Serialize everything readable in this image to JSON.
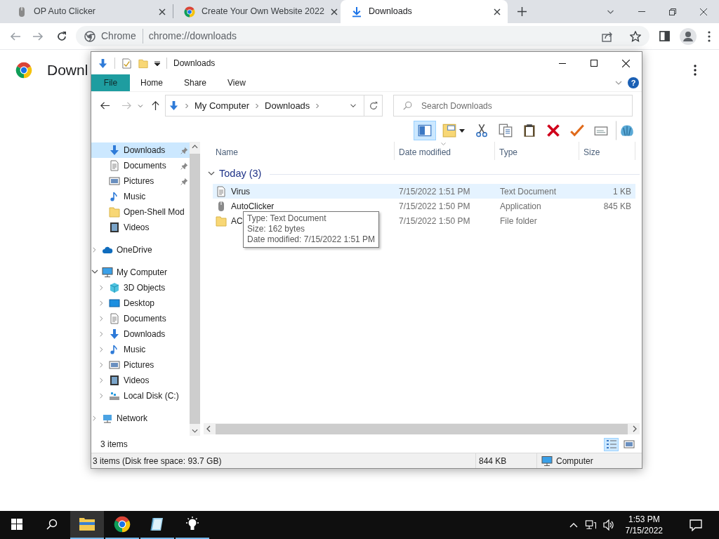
{
  "browser": {
    "tabs": [
      {
        "title": "OP Auto Clicker",
        "kind": "mouse",
        "selected": false
      },
      {
        "title": "Create Your Own Website 2022",
        "kind": "chrome",
        "selected": false
      },
      {
        "title": "Downloads",
        "kind": "download",
        "selected": true
      }
    ],
    "omnibox": {
      "chip": "Chrome",
      "url": "chrome://downloads"
    },
    "page": {
      "heading": "Downl"
    }
  },
  "explorer": {
    "title": "Downloads",
    "ribbon_tabs": [
      {
        "label": "File",
        "kind": "file",
        "selected": false
      },
      {
        "label": "Home",
        "kind": "tab",
        "selected": false
      },
      {
        "label": "Share",
        "kind": "tab",
        "selected": false
      },
      {
        "label": "View",
        "kind": "tab",
        "selected": false
      }
    ],
    "help": "?",
    "breadcrumb": [
      "My Computer",
      "Downloads"
    ],
    "search": {
      "placeholder": "Search Downloads"
    },
    "toolbar": [
      {
        "kind": "pane",
        "pressed": true
      },
      {
        "kind": "view",
        "pressed": false
      },
      {
        "kind": "cut",
        "pressed": false
      },
      {
        "kind": "copy",
        "pressed": false
      },
      {
        "kind": "paste",
        "pressed": false
      },
      {
        "kind": "delete",
        "pressed": false
      },
      {
        "kind": "properties",
        "pressed": false
      },
      {
        "kind": "rename",
        "pressed": false
      },
      {
        "kind": "shell",
        "pressed": false
      }
    ],
    "quick_access": [
      {
        "label": "Downloads",
        "kind": "downloads",
        "pinned": true,
        "selected": true
      },
      {
        "label": "Documents",
        "kind": "documents",
        "pinned": true,
        "selected": false
      },
      {
        "label": "Pictures",
        "kind": "pictures",
        "pinned": true,
        "selected": false
      },
      {
        "label": "Music",
        "kind": "music",
        "pinned": false,
        "selected": false
      },
      {
        "label": "Open-Shell Mod",
        "kind": "folder",
        "pinned": false,
        "selected": false
      },
      {
        "label": "Videos",
        "kind": "videos",
        "pinned": false,
        "selected": false
      }
    ],
    "tree": [
      {
        "label": "OneDrive",
        "kind": "onedrive",
        "expanded": false,
        "selected": false
      },
      {
        "label": "My Computer",
        "kind": "computer",
        "expanded": true,
        "selected": false,
        "children": [
          {
            "label": "3D Objects",
            "kind": "objects",
            "expanded": false,
            "selected": false
          },
          {
            "label": "Desktop",
            "kind": "desktop",
            "expanded": false,
            "selected": false
          },
          {
            "label": "Documents",
            "kind": "documents",
            "expanded": false,
            "selected": false
          },
          {
            "label": "Downloads",
            "kind": "downloads",
            "expanded": false,
            "selected": false
          },
          {
            "label": "Music",
            "kind": "music",
            "expanded": false,
            "selected": false
          },
          {
            "label": "Pictures",
            "kind": "pictures",
            "expanded": false,
            "selected": false
          },
          {
            "label": "Videos",
            "kind": "videos",
            "expanded": false,
            "selected": false
          },
          {
            "label": "Local Disk (C:)",
            "kind": "disk",
            "expanded": false,
            "selected": false
          }
        ]
      },
      {
        "label": "Network",
        "kind": "network",
        "expanded": false,
        "selected": false
      }
    ],
    "columns": [
      "Name",
      "Date modified",
      "Type",
      "Size"
    ],
    "groups": [
      {
        "label": "Today (3)",
        "expanded": true,
        "rows": [
          {
            "kind": "text",
            "name": "Virus",
            "date": "7/15/2022 1:51 PM",
            "type": "Text Document",
            "size": "1 KB",
            "selected": true
          },
          {
            "kind": "app",
            "name": "AutoClicker",
            "date": "7/15/2022 1:50 PM",
            "type": "Application",
            "size": "845 KB",
            "selected": false
          },
          {
            "kind": "folder",
            "name": "AC",
            "date": "7/15/2022 1:50 PM",
            "type": "File folder",
            "selected": false
          }
        ]
      }
    ],
    "tooltip": [
      "Type: Text Document",
      "Size: 162 bytes",
      "Date modified: 7/15/2022 1:51 PM"
    ],
    "item_count": "3 items",
    "view_buttons": [
      {
        "kind": "details",
        "selected": true
      },
      {
        "kind": "large",
        "selected": false
      }
    ],
    "status_bar": {
      "summary": "3 items (Disk free space: 93.7 GB)",
      "size": "844 KB",
      "zone": "Computer"
    }
  },
  "taskbar": {
    "apps": [
      {
        "kind": "explorer",
        "active": true,
        "running": true
      },
      {
        "kind": "chrome",
        "active": false,
        "running": true
      },
      {
        "kind": "notebook",
        "active": false,
        "running": true
      },
      {
        "kind": "bulb",
        "active": false,
        "running": true
      }
    ],
    "clock": {
      "time": "1:53 PM",
      "date": "7/15/2022"
    }
  }
}
